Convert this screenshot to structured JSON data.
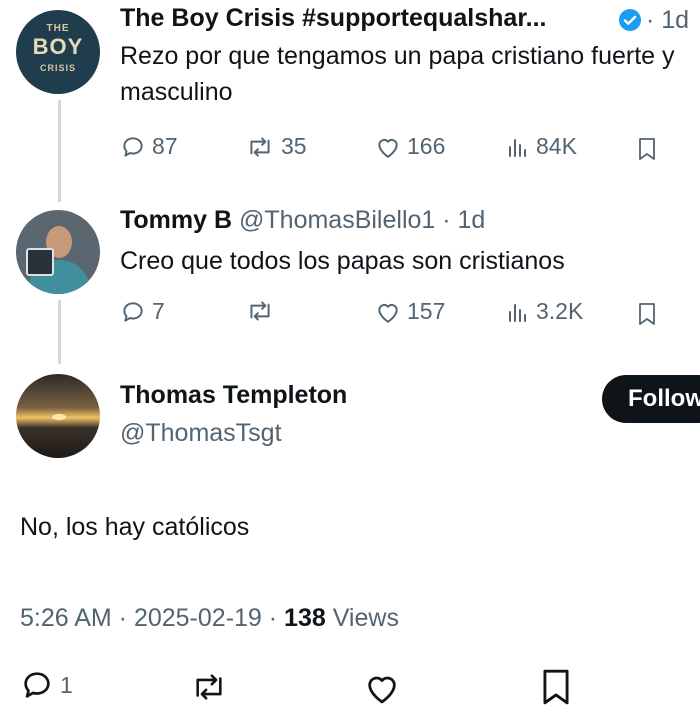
{
  "tweet1": {
    "avatar_top": "THE",
    "avatar_mid": "BOY",
    "avatar_bottom": "CRISIS",
    "display_name": "The Boy Crisis #supportequalshar...",
    "time": "· 1d",
    "text": "Rezo por que tengamos un papa cristiano fuerte y masculino",
    "replies": "87",
    "reposts": "35",
    "likes": "166",
    "views": "84K"
  },
  "tweet2": {
    "display_name": "Tommy B",
    "handle": "@ThomasBilello1 · 1d",
    "text": "Creo que todos los papas son cristianos",
    "replies": "7",
    "likes": "157",
    "views": "3.2K"
  },
  "main": {
    "display_name": "Thomas Templeton",
    "handle": "@ThomasTsgt",
    "follow_label": "Follow",
    "text": "No, los hay católicos",
    "time": "5:26 AM · 2025-02-19 · ",
    "views_count": "138",
    "views_label": " Views",
    "replies": "1"
  },
  "colors": {
    "text": "#0f1419",
    "secondary": "#536471",
    "verified": "#1d9bf0",
    "thread_line": "#cfd9de"
  }
}
